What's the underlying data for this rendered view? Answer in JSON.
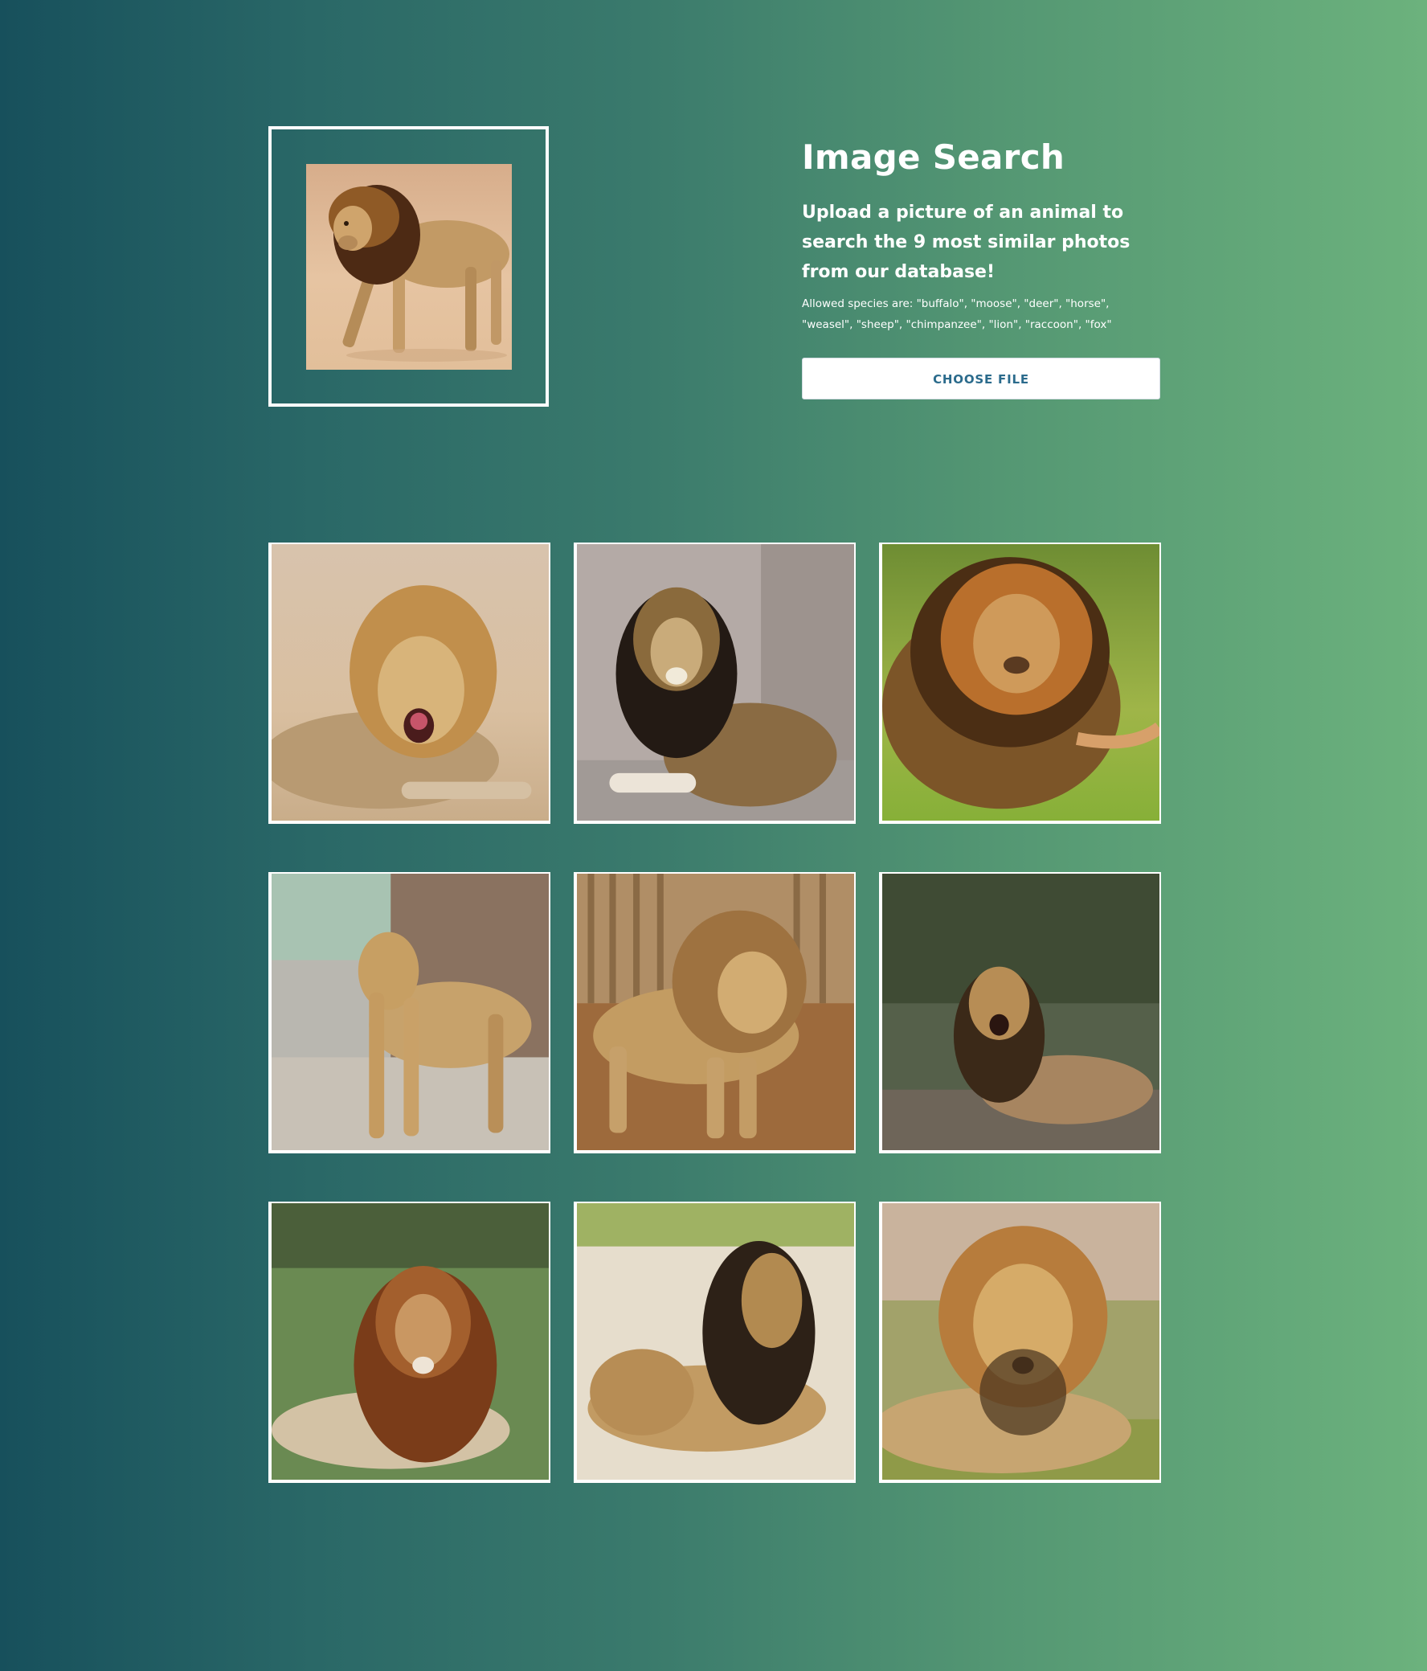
{
  "header": {
    "title": "Image Search",
    "subtitle": "Upload a picture of an animal to search the 9 most similar photos from our database!",
    "allowed_species": "Allowed species are: \"buffalo\", \"moose\", \"deer\", \"horse\", \"weasel\", \"sheep\", \"chimpanzee\", \"lion\", \"raccoon\", \"fox\""
  },
  "upload": {
    "button_label": "CHOOSE FILE",
    "preview_subject": "walking lion on sand"
  },
  "results": {
    "count": 9,
    "items": [
      {
        "subject": "roaring lion lying on dry ground"
      },
      {
        "subject": "black-maned lion resting on rocks"
      },
      {
        "subject": "dark-maned lion walking on grass"
      },
      {
        "subject": "young lion standing by a tree trunk"
      },
      {
        "subject": "lion walking near wooden fence"
      },
      {
        "subject": "lion lying in dense bush"
      },
      {
        "subject": "lion lying on green grass"
      },
      {
        "subject": "black-maned lion lying on sand"
      },
      {
        "subject": "lion resting in tall grass"
      }
    ]
  }
}
